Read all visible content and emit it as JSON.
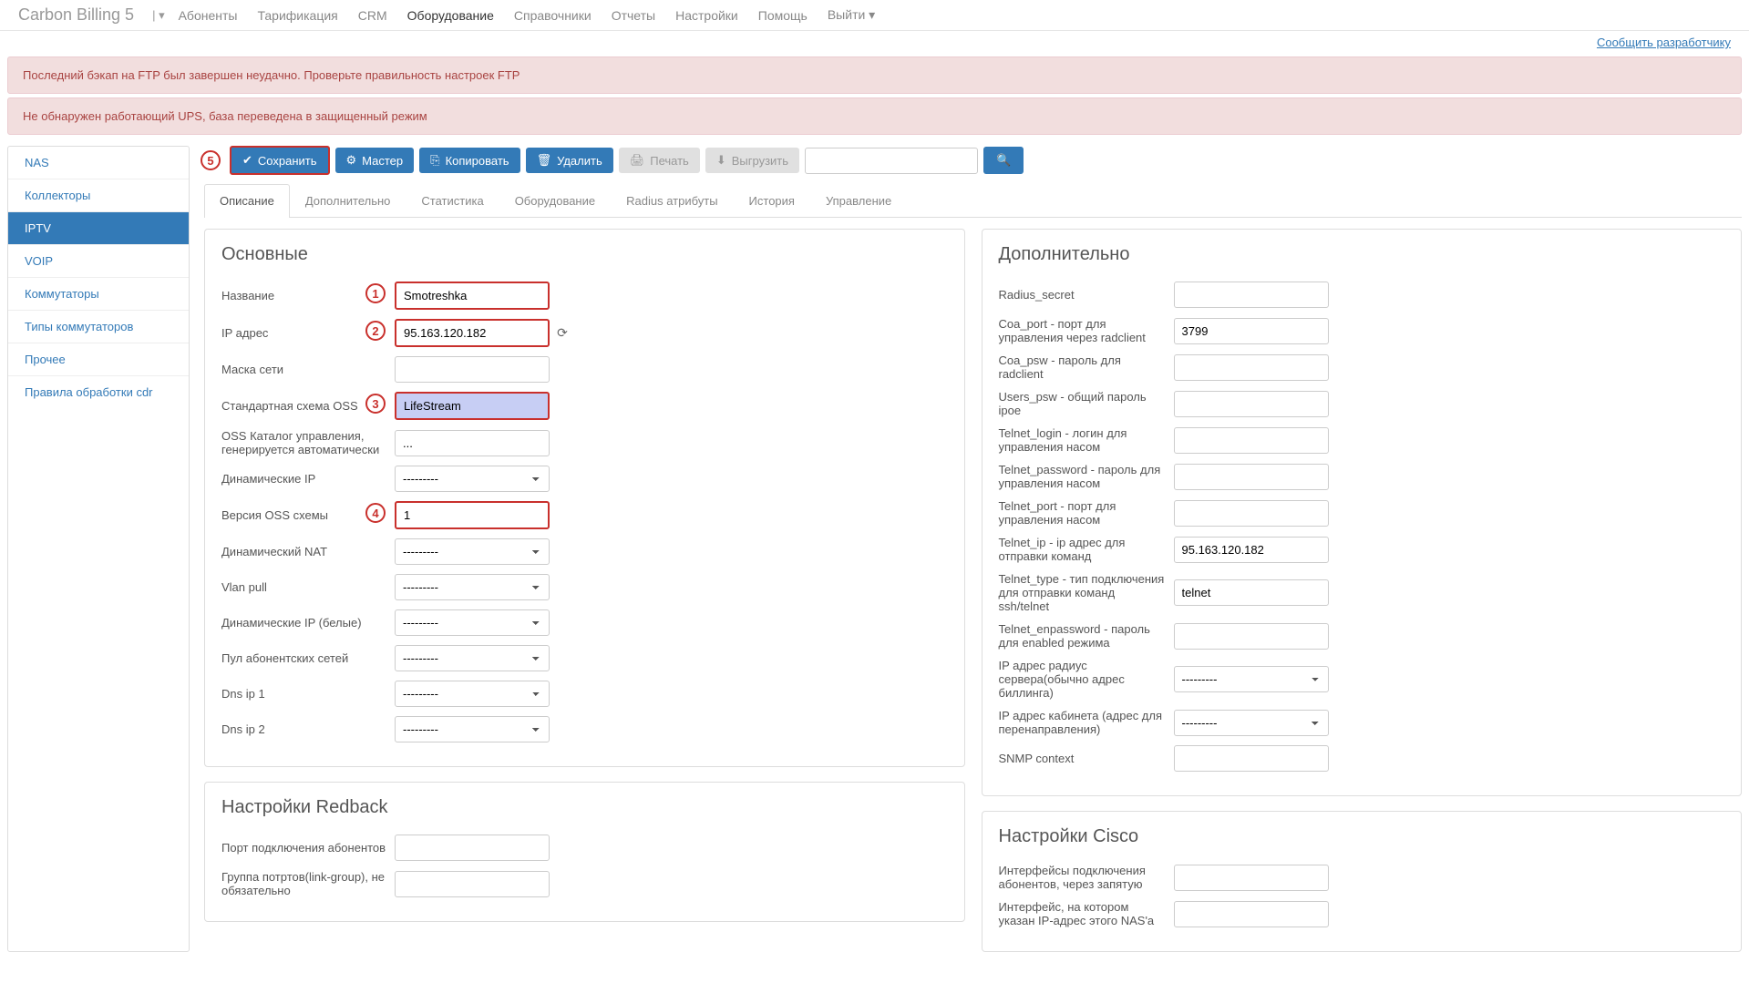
{
  "brand": "Carbon Billing 5",
  "topnav": {
    "items": [
      "Абоненты",
      "Тарификация",
      "CRM",
      "Оборудование",
      "Справочники",
      "Отчеты",
      "Настройки",
      "Помощь",
      "Выйти"
    ],
    "active_index": 3
  },
  "report_link": "Сообщить разработчику",
  "alerts": [
    "Последний бэкап на FTP был завершен неудачно. Проверьте правильность настроек FTP",
    "Не обнаружен работающий UPS, база переведена в защищенный режим"
  ],
  "sidebar": {
    "items": [
      "NAS",
      "Коллекторы",
      "IPTV",
      "VOIP",
      "Коммутаторы",
      "Типы коммутаторов",
      "Прочее",
      "Правила обработки cdr"
    ],
    "active_index": 2
  },
  "toolbar": {
    "save": "Сохранить",
    "master": "Мастер",
    "copy": "Копировать",
    "delete": "Удалить",
    "print": "Печать",
    "export": "Выгрузить"
  },
  "tabs": {
    "items": [
      "Описание",
      "Дополнительно",
      "Статистика",
      "Оборудование",
      "Radius атрибуты",
      "История",
      "Управление"
    ],
    "active_index": 0
  },
  "markers": {
    "m1": "1",
    "m2": "2",
    "m3": "3",
    "m4": "4",
    "m5": "5"
  },
  "panel_main": {
    "title": "Основные",
    "name_label": "Название",
    "name_value": "Smotreshka",
    "ip_label": "IP адрес",
    "ip_value": "95.163.120.182",
    "mask_label": "Маска сети",
    "mask_value": "",
    "oss_label": "Стандартная схема OSS",
    "oss_value": "LifeStream",
    "oss_cat_label": "OSS Каталог управления, генерируется автоматически",
    "oss_cat_value": "...",
    "dynip_label": "Динамические IP",
    "dynip_value": "---------",
    "ossver_label": "Версия OSS схемы",
    "ossver_value": "1",
    "dnat_label": "Динамический NAT",
    "dnat_value": "---------",
    "vlan_label": "Vlan pull",
    "vlan_value": "---------",
    "dynw_label": "Динамические IP (белые)",
    "dynw_value": "---------",
    "pool_label": "Пул абонентских сетей",
    "pool_value": "---------",
    "dns1_label": "Dns ip 1",
    "dns1_value": "---------",
    "dns2_label": "Dns ip 2",
    "dns2_value": "---------"
  },
  "panel_add": {
    "title": "Дополнительно",
    "radius_secret_label": "Radius_secret",
    "radius_secret_value": "",
    "coa_port_label": "Coa_port - порт для управления через radclient",
    "coa_port_value": "3799",
    "coa_psw_label": "Coa_psw - пароль для radclient",
    "coa_psw_value": "",
    "users_psw_label": "Users_psw - общий пароль ipoe",
    "users_psw_value": "",
    "telnet_login_label": "Telnet_login - логин для управления насом",
    "telnet_login_value": "",
    "telnet_pass_label": "Telnet_password - пароль для управления насом",
    "telnet_pass_value": "",
    "telnet_port_label": "Telnet_port - порт для управления насом",
    "telnet_port_value": "",
    "telnet_ip_label": "Telnet_ip - ip адрес для отправки команд",
    "telnet_ip_value": "95.163.120.182",
    "telnet_type_label": "Telnet_type - тип подключения для отправки команд ssh/telnet",
    "telnet_type_value": "telnet",
    "telnet_enp_label": "Telnet_enpassword - пароль для enabled режима",
    "telnet_enp_value": "",
    "radius_srv_label": "IP адрес радиус сервера(обычно адрес биллинга)",
    "radius_srv_value": "---------",
    "cab_ip_label": "IP адрес кабинета (адрес для перенаправления)",
    "cab_ip_value": "---------",
    "snmp_label": "SNMP context",
    "snmp_value": ""
  },
  "panel_redback": {
    "title": "Настройки Redback",
    "port_label": "Порт подключения абонентов",
    "port_value": "",
    "group_label": "Группа потртов(link-group), не обязательно",
    "group_value": ""
  },
  "panel_cisco": {
    "title": "Настройки Cisco",
    "iface_label": "Интерфейсы подключения абонентов, через запятую",
    "iface_value": "",
    "ipiface_label": "Интерфейс, на котором указан IP-адрес этого NAS'а",
    "ipiface_value": ""
  }
}
